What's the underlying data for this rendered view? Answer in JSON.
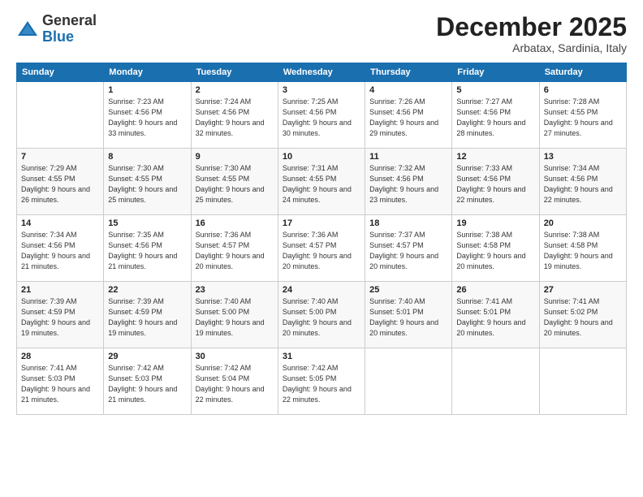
{
  "logo": {
    "general": "General",
    "blue": "Blue"
  },
  "header": {
    "month": "December 2025",
    "location": "Arbatax, Sardinia, Italy"
  },
  "weekdays": [
    "Sunday",
    "Monday",
    "Tuesday",
    "Wednesday",
    "Thursday",
    "Friday",
    "Saturday"
  ],
  "weeks": [
    [
      {
        "day": "",
        "sunrise": "",
        "sunset": "",
        "daylight": ""
      },
      {
        "day": "1",
        "sunrise": "Sunrise: 7:23 AM",
        "sunset": "Sunset: 4:56 PM",
        "daylight": "Daylight: 9 hours and 33 minutes."
      },
      {
        "day": "2",
        "sunrise": "Sunrise: 7:24 AM",
        "sunset": "Sunset: 4:56 PM",
        "daylight": "Daylight: 9 hours and 32 minutes."
      },
      {
        "day": "3",
        "sunrise": "Sunrise: 7:25 AM",
        "sunset": "Sunset: 4:56 PM",
        "daylight": "Daylight: 9 hours and 30 minutes."
      },
      {
        "day": "4",
        "sunrise": "Sunrise: 7:26 AM",
        "sunset": "Sunset: 4:56 PM",
        "daylight": "Daylight: 9 hours and 29 minutes."
      },
      {
        "day": "5",
        "sunrise": "Sunrise: 7:27 AM",
        "sunset": "Sunset: 4:56 PM",
        "daylight": "Daylight: 9 hours and 28 minutes."
      },
      {
        "day": "6",
        "sunrise": "Sunrise: 7:28 AM",
        "sunset": "Sunset: 4:55 PM",
        "daylight": "Daylight: 9 hours and 27 minutes."
      }
    ],
    [
      {
        "day": "7",
        "sunrise": "Sunrise: 7:29 AM",
        "sunset": "Sunset: 4:55 PM",
        "daylight": "Daylight: 9 hours and 26 minutes."
      },
      {
        "day": "8",
        "sunrise": "Sunrise: 7:30 AM",
        "sunset": "Sunset: 4:55 PM",
        "daylight": "Daylight: 9 hours and 25 minutes."
      },
      {
        "day": "9",
        "sunrise": "Sunrise: 7:30 AM",
        "sunset": "Sunset: 4:55 PM",
        "daylight": "Daylight: 9 hours and 25 minutes."
      },
      {
        "day": "10",
        "sunrise": "Sunrise: 7:31 AM",
        "sunset": "Sunset: 4:55 PM",
        "daylight": "Daylight: 9 hours and 24 minutes."
      },
      {
        "day": "11",
        "sunrise": "Sunrise: 7:32 AM",
        "sunset": "Sunset: 4:56 PM",
        "daylight": "Daylight: 9 hours and 23 minutes."
      },
      {
        "day": "12",
        "sunrise": "Sunrise: 7:33 AM",
        "sunset": "Sunset: 4:56 PM",
        "daylight": "Daylight: 9 hours and 22 minutes."
      },
      {
        "day": "13",
        "sunrise": "Sunrise: 7:34 AM",
        "sunset": "Sunset: 4:56 PM",
        "daylight": "Daylight: 9 hours and 22 minutes."
      }
    ],
    [
      {
        "day": "14",
        "sunrise": "Sunrise: 7:34 AM",
        "sunset": "Sunset: 4:56 PM",
        "daylight": "Daylight: 9 hours and 21 minutes."
      },
      {
        "day": "15",
        "sunrise": "Sunrise: 7:35 AM",
        "sunset": "Sunset: 4:56 PM",
        "daylight": "Daylight: 9 hours and 21 minutes."
      },
      {
        "day": "16",
        "sunrise": "Sunrise: 7:36 AM",
        "sunset": "Sunset: 4:57 PM",
        "daylight": "Daylight: 9 hours and 20 minutes."
      },
      {
        "day": "17",
        "sunrise": "Sunrise: 7:36 AM",
        "sunset": "Sunset: 4:57 PM",
        "daylight": "Daylight: 9 hours and 20 minutes."
      },
      {
        "day": "18",
        "sunrise": "Sunrise: 7:37 AM",
        "sunset": "Sunset: 4:57 PM",
        "daylight": "Daylight: 9 hours and 20 minutes."
      },
      {
        "day": "19",
        "sunrise": "Sunrise: 7:38 AM",
        "sunset": "Sunset: 4:58 PM",
        "daylight": "Daylight: 9 hours and 20 minutes."
      },
      {
        "day": "20",
        "sunrise": "Sunrise: 7:38 AM",
        "sunset": "Sunset: 4:58 PM",
        "daylight": "Daylight: 9 hours and 19 minutes."
      }
    ],
    [
      {
        "day": "21",
        "sunrise": "Sunrise: 7:39 AM",
        "sunset": "Sunset: 4:59 PM",
        "daylight": "Daylight: 9 hours and 19 minutes."
      },
      {
        "day": "22",
        "sunrise": "Sunrise: 7:39 AM",
        "sunset": "Sunset: 4:59 PM",
        "daylight": "Daylight: 9 hours and 19 minutes."
      },
      {
        "day": "23",
        "sunrise": "Sunrise: 7:40 AM",
        "sunset": "Sunset: 5:00 PM",
        "daylight": "Daylight: 9 hours and 19 minutes."
      },
      {
        "day": "24",
        "sunrise": "Sunrise: 7:40 AM",
        "sunset": "Sunset: 5:00 PM",
        "daylight": "Daylight: 9 hours and 20 minutes."
      },
      {
        "day": "25",
        "sunrise": "Sunrise: 7:40 AM",
        "sunset": "Sunset: 5:01 PM",
        "daylight": "Daylight: 9 hours and 20 minutes."
      },
      {
        "day": "26",
        "sunrise": "Sunrise: 7:41 AM",
        "sunset": "Sunset: 5:01 PM",
        "daylight": "Daylight: 9 hours and 20 minutes."
      },
      {
        "day": "27",
        "sunrise": "Sunrise: 7:41 AM",
        "sunset": "Sunset: 5:02 PM",
        "daylight": "Daylight: 9 hours and 20 minutes."
      }
    ],
    [
      {
        "day": "28",
        "sunrise": "Sunrise: 7:41 AM",
        "sunset": "Sunset: 5:03 PM",
        "daylight": "Daylight: 9 hours and 21 minutes."
      },
      {
        "day": "29",
        "sunrise": "Sunrise: 7:42 AM",
        "sunset": "Sunset: 5:03 PM",
        "daylight": "Daylight: 9 hours and 21 minutes."
      },
      {
        "day": "30",
        "sunrise": "Sunrise: 7:42 AM",
        "sunset": "Sunset: 5:04 PM",
        "daylight": "Daylight: 9 hours and 22 minutes."
      },
      {
        "day": "31",
        "sunrise": "Sunrise: 7:42 AM",
        "sunset": "Sunset: 5:05 PM",
        "daylight": "Daylight: 9 hours and 22 minutes."
      },
      {
        "day": "",
        "sunrise": "",
        "sunset": "",
        "daylight": ""
      },
      {
        "day": "",
        "sunrise": "",
        "sunset": "",
        "daylight": ""
      },
      {
        "day": "",
        "sunrise": "",
        "sunset": "",
        "daylight": ""
      }
    ]
  ]
}
